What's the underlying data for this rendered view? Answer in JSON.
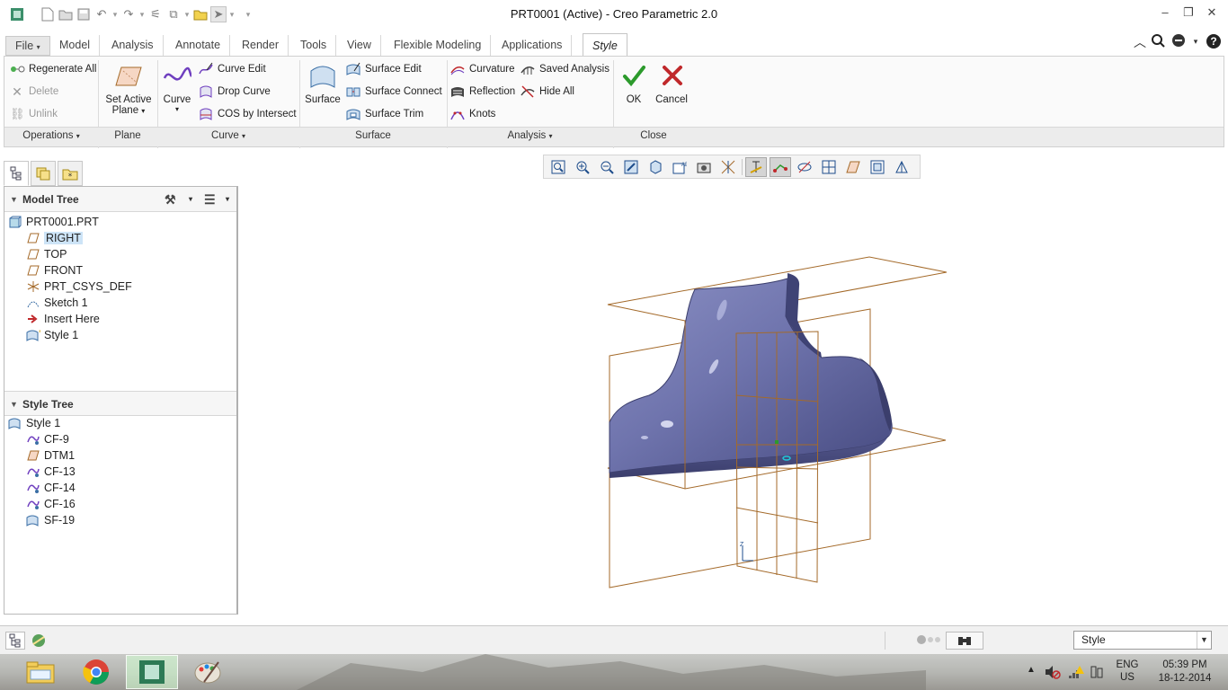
{
  "window": {
    "title": "PRT0001 (Active) - Creo Parametric 2.0"
  },
  "menu_tabs": [
    {
      "label": "File"
    },
    {
      "label": "Model"
    },
    {
      "label": "Analysis"
    },
    {
      "label": "Annotate"
    },
    {
      "label": "Render"
    },
    {
      "label": "Tools"
    },
    {
      "label": "View"
    },
    {
      "label": "Flexible Modeling"
    },
    {
      "label": "Applications"
    },
    {
      "label": "Style"
    }
  ],
  "ribbon": {
    "operations": {
      "regenerate_all": "Regenerate All",
      "delete": "Delete",
      "unlink": "Unlink",
      "label": "Operations"
    },
    "plane": {
      "set_active_line1": "Set Active",
      "set_active_line2": "Plane",
      "label": "Plane"
    },
    "curve": {
      "curve": "Curve",
      "curve_edit": "Curve Edit",
      "drop_curve": "Drop Curve",
      "cos_by_intersect": "COS by Intersect",
      "label": "Curve"
    },
    "surface": {
      "surface": "Surface",
      "surface_edit": "Surface Edit",
      "surface_connect": "Surface Connect",
      "surface_trim": "Surface Trim",
      "label": "Surface"
    },
    "analysis": {
      "curvature": "Curvature",
      "reflection": "Reflection",
      "knots": "Knots",
      "saved_analysis": "Saved Analysis",
      "hide_all": "Hide All",
      "label": "Analysis"
    },
    "close": {
      "ok": "OK",
      "cancel": "Cancel",
      "label": "Close"
    }
  },
  "model_tree": {
    "title": "Model Tree",
    "items": [
      {
        "label": "PRT0001.PRT",
        "icon": "part-icon"
      },
      {
        "label": "RIGHT",
        "icon": "datum-plane-icon"
      },
      {
        "label": "TOP",
        "icon": "datum-plane-icon"
      },
      {
        "label": "FRONT",
        "icon": "datum-plane-icon"
      },
      {
        "label": "PRT_CSYS_DEF",
        "icon": "csys-icon"
      },
      {
        "label": "Sketch 1",
        "icon": "sketch-icon"
      },
      {
        "label": "Insert Here",
        "icon": "insert-arrow-icon"
      },
      {
        "label": "Style 1",
        "icon": "style-feature-icon"
      }
    ],
    "selected": "RIGHT"
  },
  "style_tree": {
    "title": "Style Tree",
    "items": [
      {
        "label": "Style 1",
        "icon": "style-feature-icon"
      },
      {
        "label": "CF-9",
        "icon": "curve-feature-icon"
      },
      {
        "label": "DTM1",
        "icon": "datum-plane-icon"
      },
      {
        "label": "CF-13",
        "icon": "curve-feature-icon"
      },
      {
        "label": "CF-14",
        "icon": "curve-feature-icon"
      },
      {
        "label": "CF-16",
        "icon": "curve-feature-icon"
      },
      {
        "label": "SF-19",
        "icon": "surface-feature-icon"
      }
    ]
  },
  "statusbar": {
    "filter_value": "Style"
  },
  "taskbar": {
    "lang_line1": "ENG",
    "lang_line2": "US",
    "time": "05:39 PM",
    "date": "18-12-2014"
  },
  "colors": {
    "surface": "#6f74ad",
    "datum_plane": "#a46a2a",
    "ok_green": "#2c9a2c",
    "cancel_red": "#c0282b",
    "selection": "#cde4f7"
  }
}
